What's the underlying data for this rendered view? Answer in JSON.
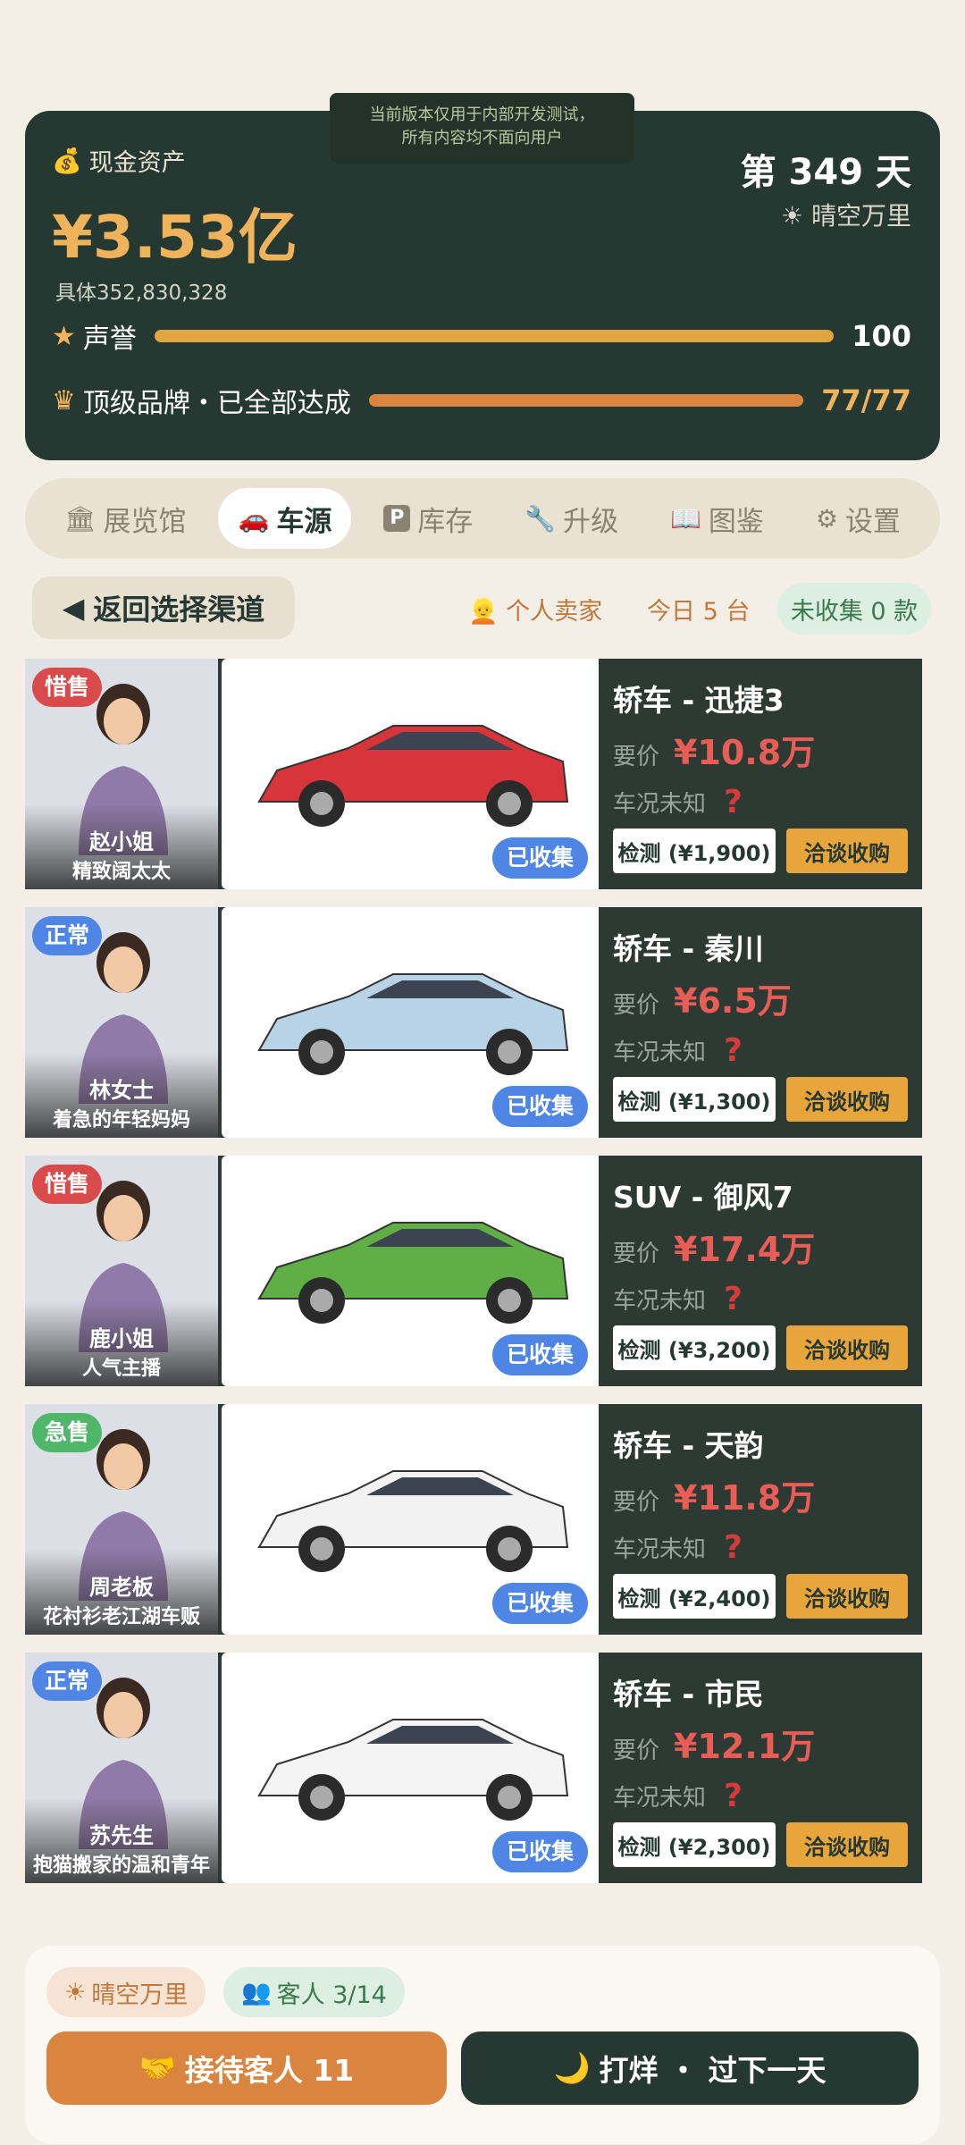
{
  "dev_banner": [
    "当前版本仅用于内部开发测试，",
    "所有内容均不面向用户"
  ],
  "stats": {
    "cash_icon": "money-bag-icon",
    "cash_label": "现金资产",
    "cash_value": "¥3.53亿",
    "cash_detail": "具体352,830,328",
    "day": "第 349 天",
    "weather": "晴空万里",
    "reputation_label": "声誉",
    "reputation_value": "100",
    "reputation_fraction": 1.0,
    "brand_label": "顶级品牌・已全部达成",
    "brand_value": "77/77",
    "brand_fraction": 1.0
  },
  "tabs": [
    {
      "label": "展览馆",
      "icon": "museum-icon",
      "active": false
    },
    {
      "label": "车源",
      "icon": "car-icon",
      "active": true
    },
    {
      "label": "库存",
      "icon": "parking-icon",
      "active": false
    },
    {
      "label": "升级",
      "icon": "wrench-icon",
      "active": false
    },
    {
      "label": "图鉴",
      "icon": "book-icon",
      "active": false
    },
    {
      "label": "设置",
      "icon": "gear-icon",
      "active": false
    }
  ],
  "toolbar": {
    "back_label": "返回选择渠道",
    "channel": "个人卖家",
    "today": "今日 5 台",
    "uncollected": "未收集 0 款"
  },
  "listings": [
    {
      "mood": "惜售",
      "mood_color": "#d94a4a",
      "seller_name": "赵小姐",
      "seller_desc": "精致阔太太",
      "car_name": "轿车 - 迅捷3",
      "price_label": "要价",
      "price": "¥10.8万",
      "cond_label": "车况未知",
      "cond_mark": "?",
      "collected": "已收集",
      "inspect": "检测 (¥1,900)",
      "buy": "洽谈收购",
      "car_color": "#d8353a"
    },
    {
      "mood": "正常",
      "mood_color": "#4f86e6",
      "seller_name": "林女士",
      "seller_desc": "着急的年轻妈妈",
      "car_name": "轿车 - 秦川",
      "price_label": "要价",
      "price": "¥6.5万",
      "cond_label": "车况未知",
      "cond_mark": "?",
      "collected": "已收集",
      "inspect": "检测 (¥1,300)",
      "buy": "洽谈收购",
      "car_color": "#b9d3e6"
    },
    {
      "mood": "惜售",
      "mood_color": "#d94a4a",
      "seller_name": "鹿小姐",
      "seller_desc": "人气主播",
      "car_name": "SUV - 御风7",
      "price_label": "要价",
      "price": "¥17.4万",
      "cond_label": "车况未知",
      "cond_mark": "?",
      "collected": "已收集",
      "inspect": "检测 (¥3,200)",
      "buy": "洽谈收购",
      "car_color": "#5faf46"
    },
    {
      "mood": "急售",
      "mood_color": "#4fb66a",
      "seller_name": "周老板",
      "seller_desc": "花衬衫老江湖车贩",
      "car_name": "轿车 - 天韵",
      "price_label": "要价",
      "price": "¥11.8万",
      "cond_label": "车况未知",
      "cond_mark": "?",
      "collected": "已收集",
      "inspect": "检测 (¥2,400)",
      "buy": "洽谈收购",
      "car_color": "#f2f2f2"
    },
    {
      "mood": "正常",
      "mood_color": "#4f86e6",
      "seller_name": "苏先生",
      "seller_desc": "抱猫搬家的温和青年",
      "car_name": "轿车 - 市民",
      "price_label": "要价",
      "price": "¥12.1万",
      "cond_label": "车况未知",
      "cond_mark": "?",
      "collected": "已收集",
      "inspect": "检测 (¥2,300)",
      "buy": "洽谈收购",
      "car_color": "#f4f4f4"
    }
  ],
  "bottom": {
    "weather_chip": "晴空万里",
    "guests_chip": "客人 3/14",
    "receive_label": "接待客人 11",
    "close_label": "打烊 ・ 过下一天"
  }
}
